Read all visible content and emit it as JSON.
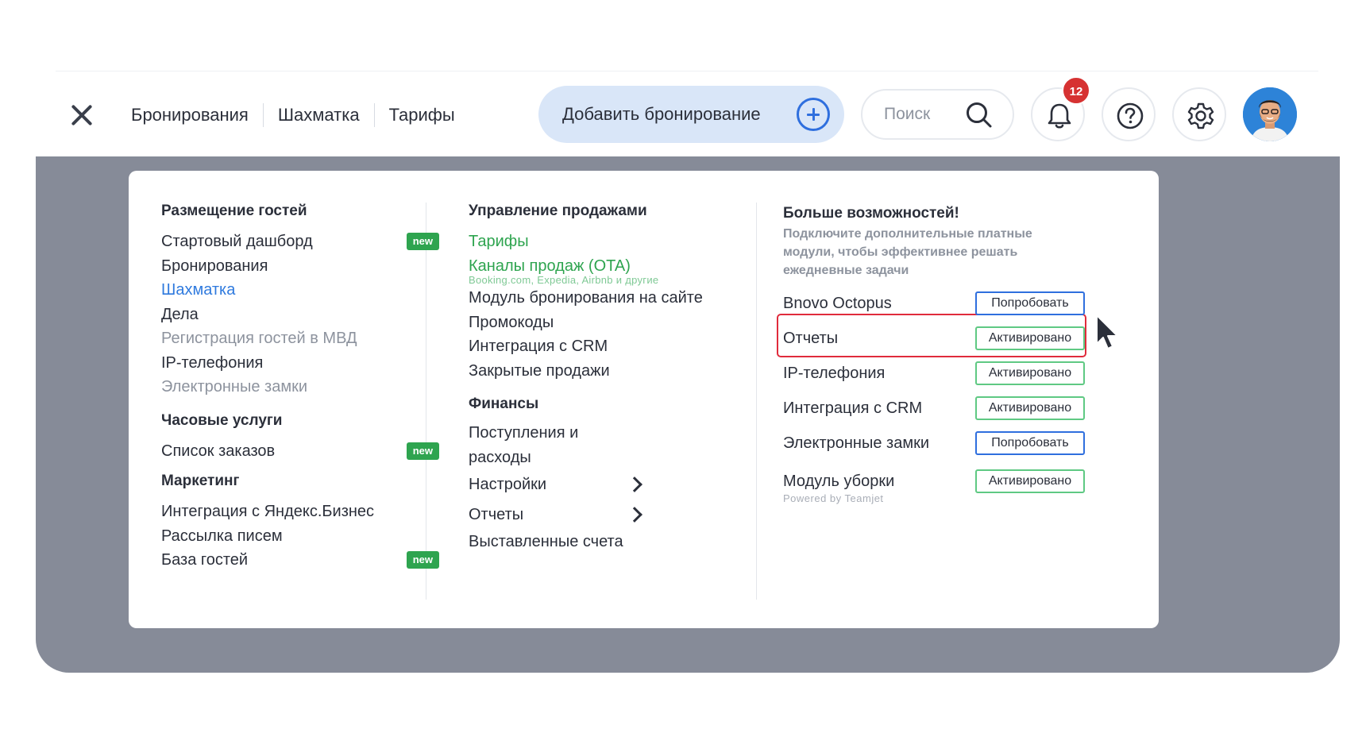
{
  "header": {
    "nav": [
      "Бронирования",
      "Шахматка",
      "Тарифы"
    ],
    "add_booking": "Добавить бронирование",
    "search_placeholder": "Поиск",
    "notifications_count": "12"
  },
  "menu": {
    "col1": {
      "sections": [
        {
          "title": "Размещение гостей",
          "items": [
            {
              "label": "Стартовый дашборд",
              "badge": "new"
            },
            {
              "label": "Бронирования"
            },
            {
              "label": "Шахматка",
              "state": "active"
            },
            {
              "label": "Дела"
            },
            {
              "label": "Регистрация гостей в МВД",
              "state": "disabled"
            },
            {
              "label": "IP-телефония"
            },
            {
              "label": "Электронные замки",
              "state": "disabled"
            }
          ]
        },
        {
          "title": "Часовые услуги",
          "items": [
            {
              "label": "Список заказов",
              "badge": "new"
            }
          ]
        },
        {
          "title": "Маркетинг",
          "items": [
            {
              "label": "Интеграция с Яндекс.Бизнес"
            },
            {
              "label": "Рассылка писем"
            },
            {
              "label": "База гостей",
              "badge": "new"
            }
          ]
        }
      ]
    },
    "col2": {
      "sales_title": "Управление продажами",
      "sales_items": [
        {
          "label": "Тарифы",
          "state": "green"
        },
        {
          "label": "Каналы продаж (OTA)",
          "state": "green",
          "sub": "Booking.com, Expedia, Airbnb и другие"
        },
        {
          "label": "Модуль бронирования на сайте"
        },
        {
          "label": "Промокоды"
        },
        {
          "label": "Интеграция с CRM"
        },
        {
          "label": "Закрытые продажи"
        }
      ],
      "finance_title": "Финансы",
      "finance_items": [
        {
          "label": "Поступления и расходы"
        },
        {
          "label": "Настройки",
          "arrow": true
        },
        {
          "label": "Отчеты",
          "arrow": true
        },
        {
          "label": "Выставленные счета"
        }
      ]
    },
    "col3": {
      "title": "Больше возможностей!",
      "text": "Подключите дополнительные платные модули, чтобы эффективнее решать ежедневные задачи",
      "modules": [
        {
          "name": "Bnovo Octopus",
          "button": "Попробовать",
          "status": "try"
        },
        {
          "name": "Отчеты",
          "button": "Активировано",
          "status": "active"
        },
        {
          "name": "IP-телефония",
          "button": "Активировано",
          "status": "active"
        },
        {
          "name": "Интеграция с CRM",
          "button": "Активировано",
          "status": "active"
        },
        {
          "name": "Электронные замки",
          "button": "Попробовать",
          "status": "try"
        },
        {
          "name": "Модуль уборки",
          "button": "Активировано",
          "status": "active",
          "powered": "Powered by Teamjet"
        }
      ]
    }
  },
  "colors": {
    "accent_blue": "#2f6fde",
    "green": "#2ea44f",
    "overlay": "#868b98",
    "highlight": "#e02b3c",
    "badge_red": "#d63232"
  }
}
